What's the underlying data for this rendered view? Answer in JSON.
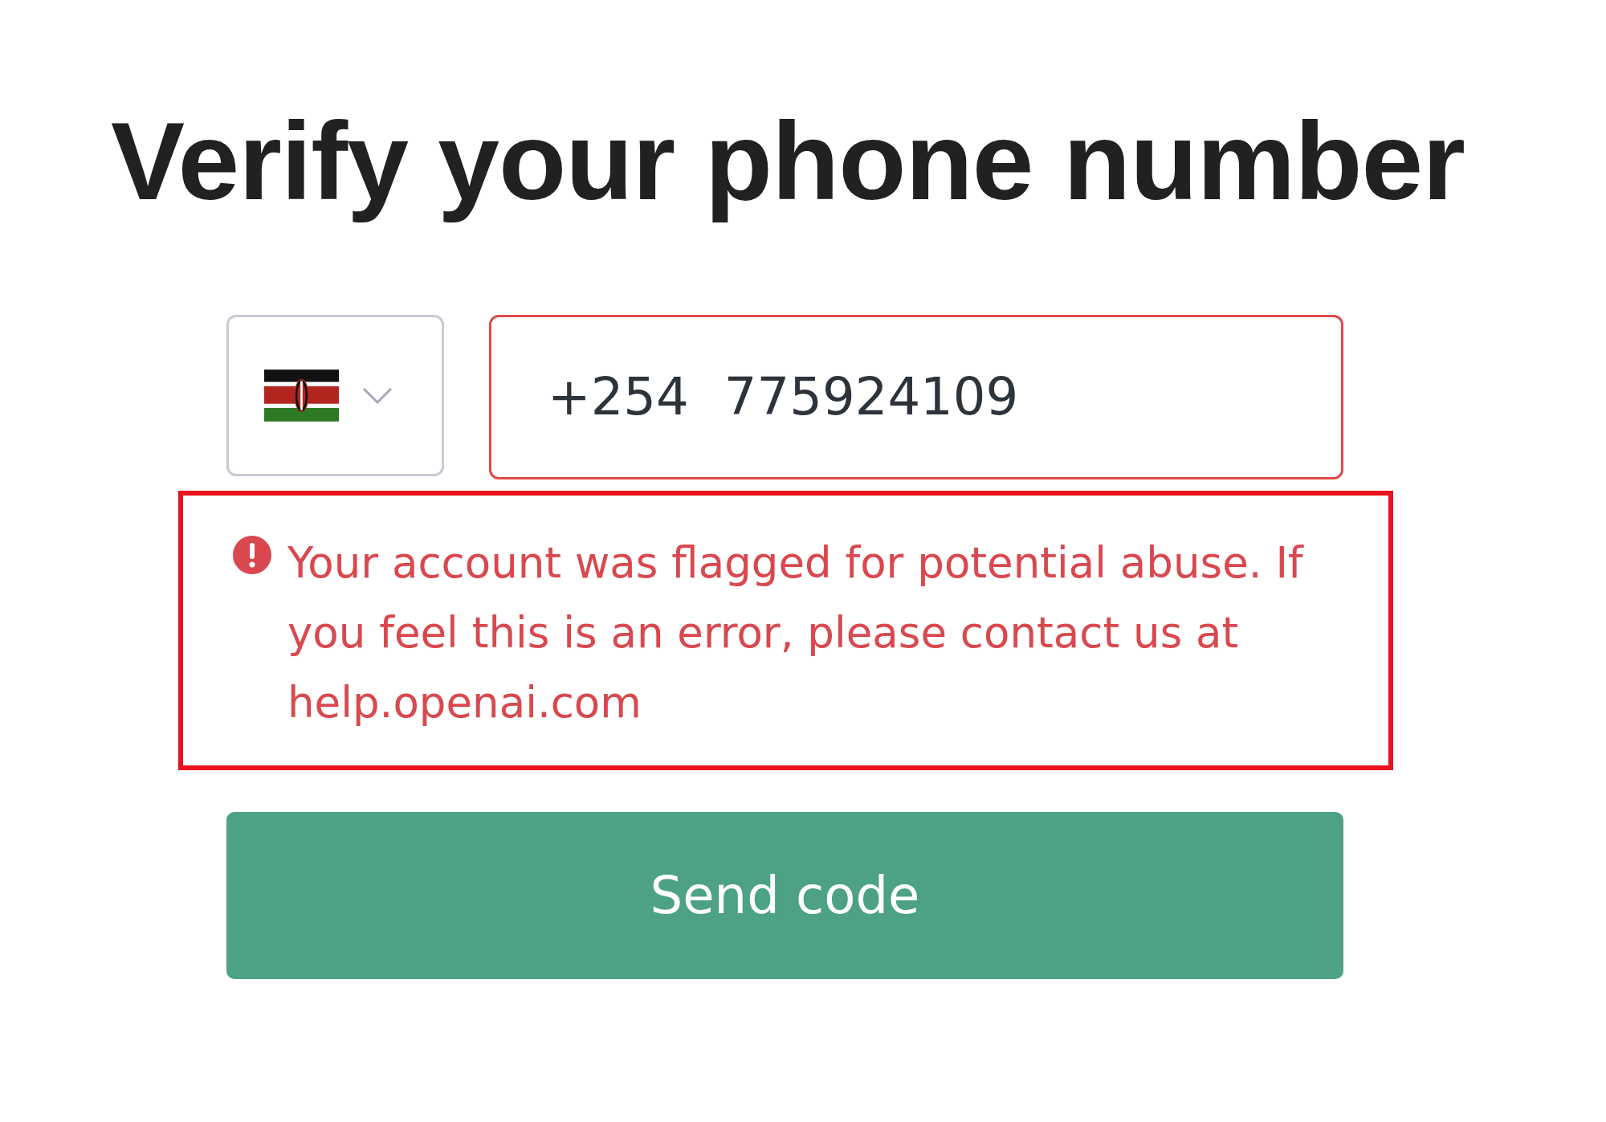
{
  "title": "Verify your phone number",
  "country_select": {
    "expanded": false
  },
  "phone_field": {
    "country_code": "+254",
    "number": "775924109",
    "invalid": true
  },
  "error": {
    "message": "Your account was flagged for potential abuse. If you feel this is an error, please contact us at",
    "link": "help.openai.com",
    "highlighted": true
  },
  "buttons": [
    {
      "label": "Send code",
      "kind": "primary"
    }
  ]
}
